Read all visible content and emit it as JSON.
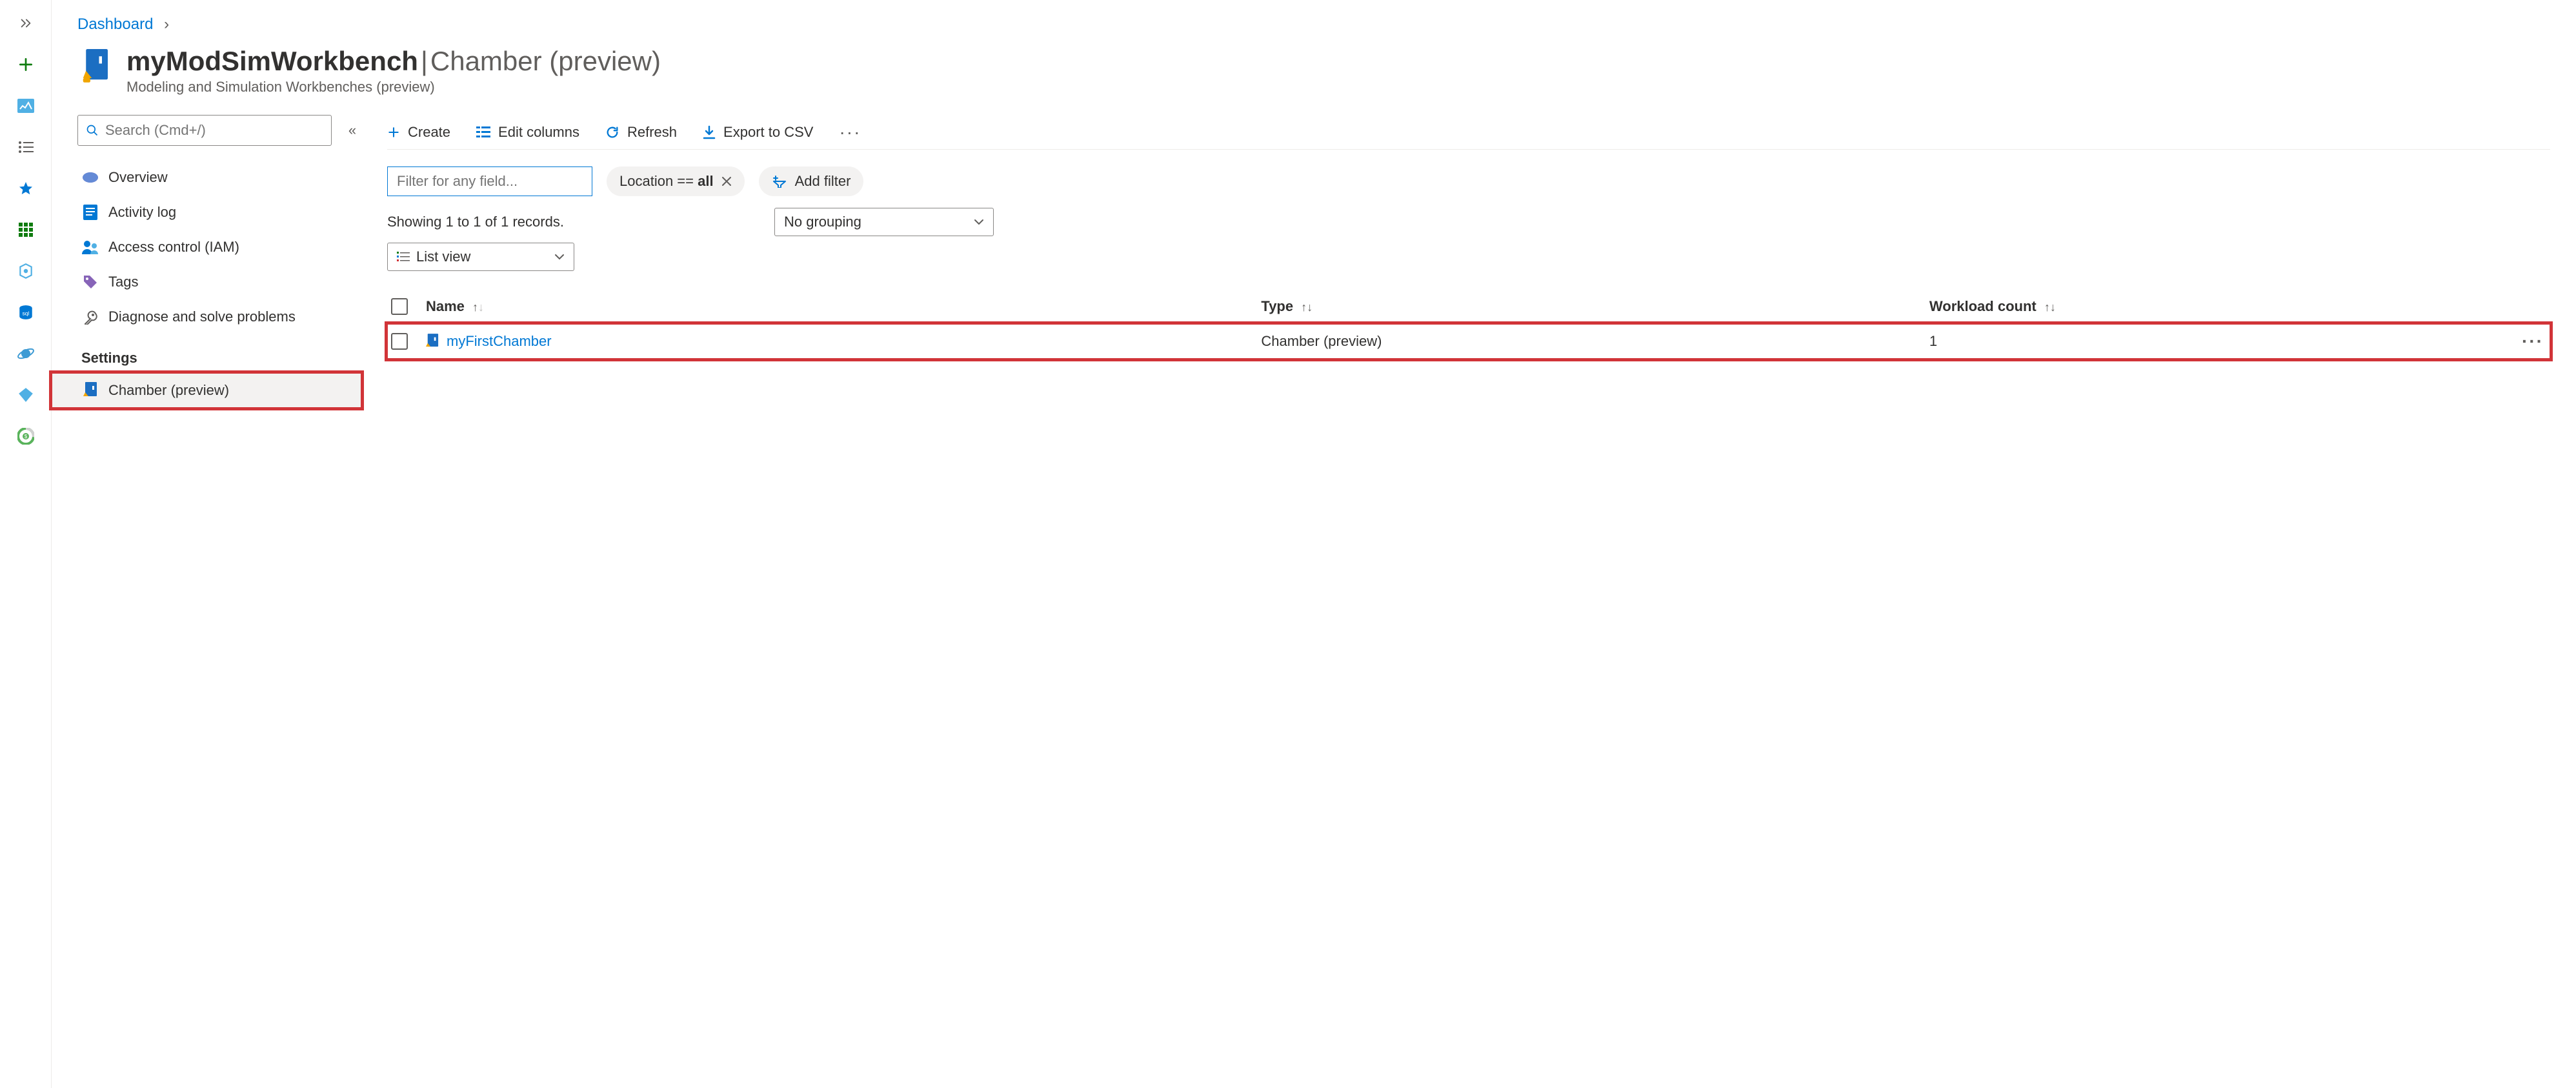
{
  "breadcrumb": {
    "dashboard": "Dashboard"
  },
  "header": {
    "title": "myModSimWorkbench",
    "section": "Chamber (preview)",
    "resource_type": "Modeling and Simulation Workbenches (preview)"
  },
  "resnav": {
    "search_placeholder": "Search (Cmd+/)",
    "items": {
      "overview": "Overview",
      "activity": "Activity log",
      "iam": "Access control (IAM)",
      "tags": "Tags",
      "diag": "Diagnose and solve problems"
    },
    "settings_heading": "Settings",
    "settings": {
      "chamber": "Chamber (preview)"
    }
  },
  "cmdbar": {
    "create": "Create",
    "edit_columns": "Edit columns",
    "refresh": "Refresh",
    "export_csv": "Export to CSV"
  },
  "filters": {
    "any_field_placeholder": "Filter for any field...",
    "location_prefix": "Location == ",
    "location_value": "all",
    "add_filter": "Add filter"
  },
  "list": {
    "summary": "Showing 1 to 1 of 1 records.",
    "view_label": "List view",
    "grouping_label": "No grouping"
  },
  "columns": {
    "name": "Name",
    "type": "Type",
    "workload": "Workload count"
  },
  "rows": [
    {
      "name": "myFirstChamber",
      "type": "Chamber (preview)",
      "workload": "1"
    }
  ]
}
